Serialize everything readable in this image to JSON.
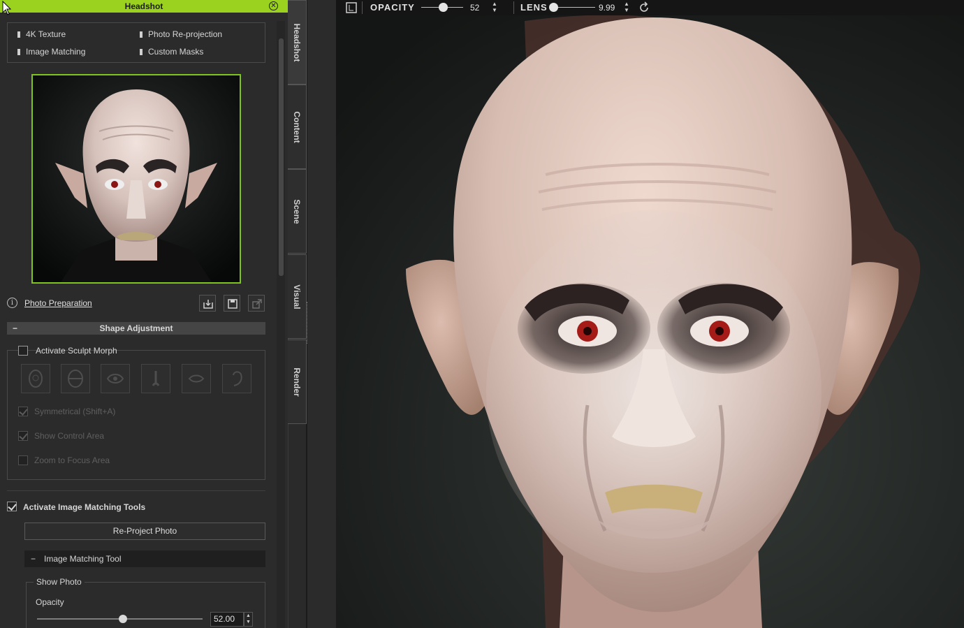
{
  "panel": {
    "title": "Headshot",
    "close_glyph": "✕",
    "features": [
      "4K Texture",
      "Photo Re-projection",
      "Image Matching",
      "Custom Masks"
    ],
    "photo_preparation": "Photo Preparation",
    "info_glyph": "i",
    "shape_adjustment": "Shape Adjustment",
    "collapse_glyph": "−",
    "activate_sculpt_morph": "Activate Sculpt Morph",
    "symmetrical": "Symmetrical (Shift+A)",
    "show_control_area": "Show Control Area",
    "zoom_to_focus": "Zoom to Focus Area",
    "activate_image_matching": "Activate Image Matching Tools",
    "reproject_photo": "Re-Project Photo",
    "image_matching_tool": "Image Matching Tool",
    "show_photo": "Show Photo",
    "opacity_label": "Opacity",
    "opacity_value": "52.00",
    "opacity_fraction": 0.52,
    "spin_glyph": "▲\n▼",
    "checks": {
      "sculpt_morph": false,
      "symmetrical": true,
      "show_control_area": true,
      "zoom_to_focus": false,
      "image_matching": true
    }
  },
  "tabs": [
    "Headshot",
    "Content",
    "Scene",
    "Visual",
    "Render"
  ],
  "active_tab": "Headshot",
  "viewport_toolbar": {
    "opacity_label": "OPACITY",
    "opacity_value": "52",
    "opacity_fraction": 0.52,
    "lens_label": "LENS",
    "lens_value": "9.99",
    "lens_fraction": 0.0,
    "spin_glyph": "▲\n▼"
  },
  "icons": {
    "close": "close-icon",
    "info": "info-icon",
    "load_photo": "load-photo-icon",
    "save": "save-icon",
    "export": "export-icon",
    "viewport_mode": "viewport-mode-icon",
    "reset": "reset-icon",
    "morph_tools": [
      "face-icon",
      "head-icon",
      "eye-icon",
      "nose-icon",
      "mouth-icon",
      "ear-icon"
    ]
  },
  "colors": {
    "accent": "#9bd21f",
    "preview_border": "#7fc31e"
  }
}
